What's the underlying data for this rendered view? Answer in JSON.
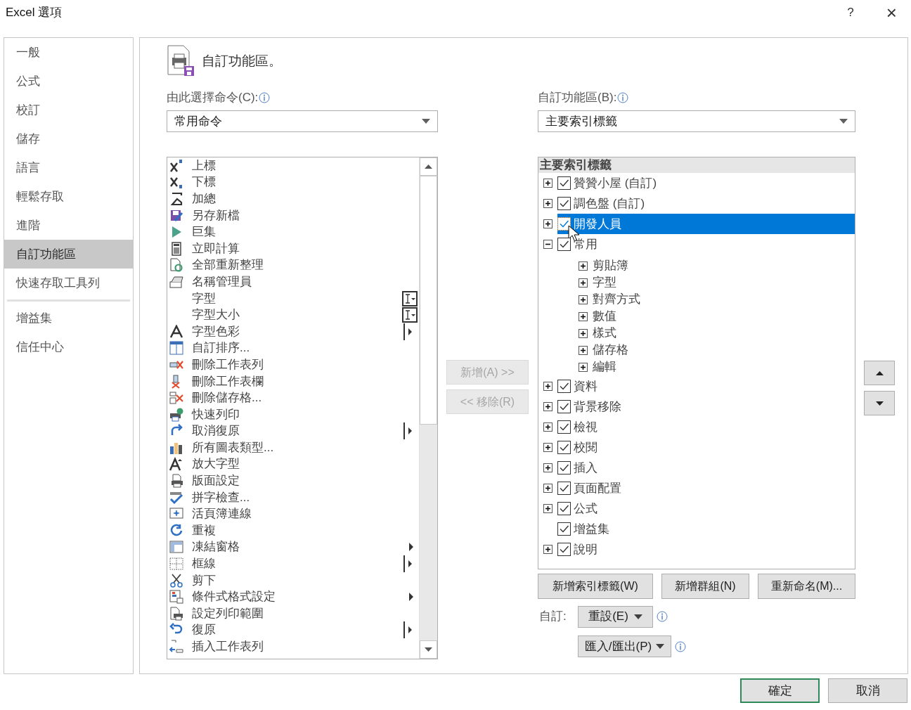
{
  "window": {
    "title": "Excel 選項",
    "help": "?",
    "close": "×"
  },
  "sidebar": {
    "groups": [
      [
        {
          "label": "一般",
          "selected": false
        },
        {
          "label": "公式",
          "selected": false
        },
        {
          "label": "校訂",
          "selected": false
        },
        {
          "label": "儲存",
          "selected": false
        },
        {
          "label": "語言",
          "selected": false
        },
        {
          "label": "輕鬆存取",
          "selected": false
        },
        {
          "label": "進階",
          "selected": false
        },
        {
          "label": "自訂功能區",
          "selected": true
        },
        {
          "label": "快速存取工具列",
          "selected": false
        }
      ],
      [
        {
          "label": "增益集",
          "selected": false
        },
        {
          "label": "信任中心",
          "selected": false
        }
      ]
    ]
  },
  "heading": "自訂功能區。",
  "commands_source": {
    "label": "由此選擇命令(C):",
    "value": "常用命令"
  },
  "commands": [
    {
      "label": "上標",
      "kind": "plain"
    },
    {
      "label": "下標",
      "kind": "plain"
    },
    {
      "label": "加總",
      "kind": "plain"
    },
    {
      "label": "另存新檔",
      "kind": "plain"
    },
    {
      "label": "巨集",
      "kind": "plain"
    },
    {
      "label": "立即計算",
      "kind": "plain"
    },
    {
      "label": "全部重新整理",
      "kind": "plain"
    },
    {
      "label": "名稱管理員",
      "kind": "plain"
    },
    {
      "label": "字型",
      "kind": "field"
    },
    {
      "label": "字型大小",
      "kind": "field"
    },
    {
      "label": "字型色彩",
      "kind": "split"
    },
    {
      "label": "自訂排序...",
      "kind": "plain"
    },
    {
      "label": "刪除工作表列",
      "kind": "plain"
    },
    {
      "label": "刪除工作表欄",
      "kind": "plain"
    },
    {
      "label": "刪除儲存格...",
      "kind": "plain"
    },
    {
      "label": "快速列印",
      "kind": "plain"
    },
    {
      "label": "取消復原",
      "kind": "split"
    },
    {
      "label": "所有圖表類型...",
      "kind": "plain"
    },
    {
      "label": "放大字型",
      "kind": "plain"
    },
    {
      "label": "版面設定",
      "kind": "plain"
    },
    {
      "label": "拼字檢查...",
      "kind": "plain"
    },
    {
      "label": "活頁簿連線",
      "kind": "plain"
    },
    {
      "label": "重複",
      "kind": "plain"
    },
    {
      "label": "凍結窗格",
      "kind": "arrow"
    },
    {
      "label": "框線",
      "kind": "split"
    },
    {
      "label": "剪下",
      "kind": "plain"
    },
    {
      "label": "條件式格式設定",
      "kind": "arrow"
    },
    {
      "label": "設定列印範圍",
      "kind": "plain"
    },
    {
      "label": "復原",
      "kind": "split"
    },
    {
      "label": "插入工作表列",
      "kind": "plain"
    }
  ],
  "add_button": {
    "label": "新增(A) >>",
    "disabled": true
  },
  "remove_button": {
    "label": "<< 移除(R)",
    "disabled": true
  },
  "ribbon_target": {
    "label": "自訂功能區(B):",
    "value": "主要索引標籤"
  },
  "tree": {
    "header": "主要索引標籤",
    "items": [
      {
        "label": "贊贊小屋 (自訂)",
        "checked": true,
        "expanded": false,
        "selected": false
      },
      {
        "label": "調色盤 (自訂)",
        "checked": true,
        "expanded": false,
        "selected": false
      },
      {
        "label": "開發人員",
        "checked": true,
        "expanded": false,
        "selected": true
      },
      {
        "label": "常用",
        "checked": true,
        "expanded": true,
        "selected": false,
        "children": [
          {
            "label": "剪貼簿",
            "expanded": false
          },
          {
            "label": "字型",
            "expanded": false
          },
          {
            "label": "對齊方式",
            "expanded": false
          },
          {
            "label": "數值",
            "expanded": false
          },
          {
            "label": "樣式",
            "expanded": false
          },
          {
            "label": "儲存格",
            "expanded": false
          },
          {
            "label": "編輯",
            "expanded": false
          }
        ]
      },
      {
        "label": "資料",
        "checked": true,
        "expanded": false,
        "selected": false
      },
      {
        "label": "背景移除",
        "checked": true,
        "expanded": false,
        "selected": false
      },
      {
        "label": "檢視",
        "checked": true,
        "expanded": false,
        "selected": false
      },
      {
        "label": "校閱",
        "checked": true,
        "expanded": false,
        "selected": false
      },
      {
        "label": "插入",
        "checked": true,
        "expanded": false,
        "selected": false
      },
      {
        "label": "頁面配置",
        "checked": true,
        "expanded": false,
        "selected": false
      },
      {
        "label": "公式",
        "checked": true,
        "expanded": false,
        "selected": false
      },
      {
        "label": "增益集",
        "checked": true,
        "selected": false
      },
      {
        "label": "說明",
        "checked": true,
        "expanded": false,
        "selected": false
      }
    ]
  },
  "tree_buttons": [
    "新增索引標籤(W)",
    "新增群組(N)",
    "重新命名(M)..."
  ],
  "customize": {
    "label": "自訂:",
    "reset": "重設(E)",
    "import_export": "匯入/匯出(P)"
  },
  "footer": [
    {
      "label": "確定",
      "default": true
    },
    {
      "label": "取消",
      "default": false
    }
  ]
}
